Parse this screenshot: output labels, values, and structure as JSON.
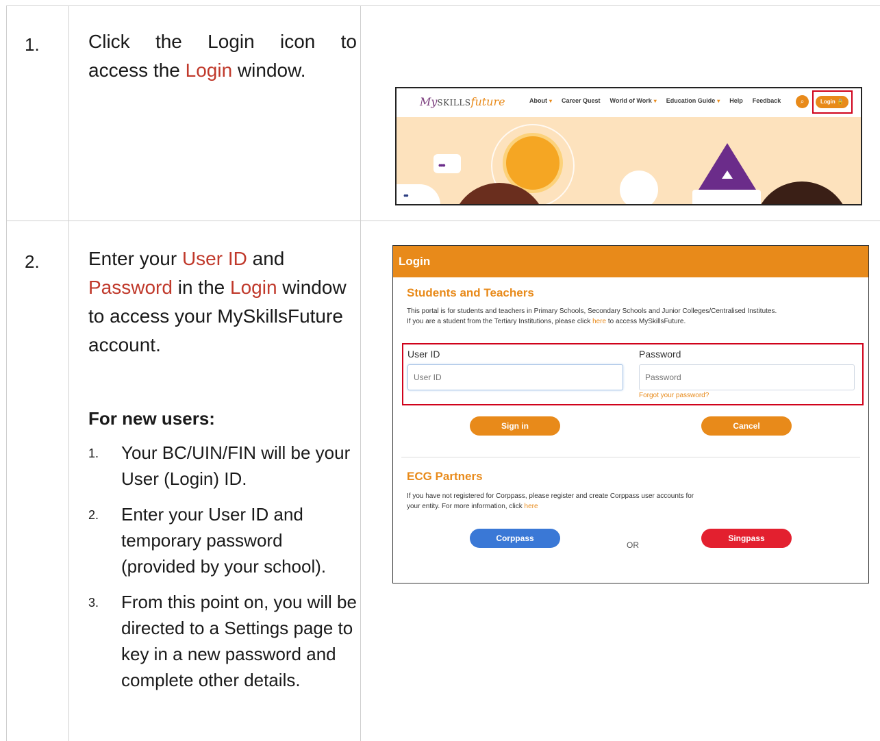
{
  "step1": {
    "number": "1.",
    "text_line1": [
      "Click",
      "the",
      "Login",
      "icon",
      "to"
    ],
    "text_pre": "access the",
    "text_highlight": "Login",
    "text_post": "window."
  },
  "step2": {
    "number": "2.",
    "p1": "Enter your",
    "h1": "User ID",
    "p2": "and",
    "h2": "Password",
    "p3": "in the",
    "h3": "Login",
    "p4": "window to access your MySkillsFuture account."
  },
  "new_users": {
    "title": "For new users:",
    "items": [
      {
        "n": "1.",
        "text": "Your BC/UIN/FIN will be your User (Login) ID."
      },
      {
        "n": "2.",
        "text": "Enter your User ID and temporary password (provided by your school)."
      },
      {
        "n": "3.",
        "text": "From this point on, you will be directed to a Settings page to key in a new password and complete other details."
      }
    ]
  },
  "screenshot1": {
    "logo_my": "My",
    "logo_skills": "SKILLS",
    "logo_future": "future",
    "nav": [
      {
        "label": "About",
        "caret": true
      },
      {
        "label": "Career Quest",
        "caret": false
      },
      {
        "label": "World of Work",
        "caret": true
      },
      {
        "label": "Education Guide",
        "caret": true
      },
      {
        "label": "Help",
        "caret": false
      },
      {
        "label": "Feedback",
        "caret": false
      }
    ],
    "login_label": "Login 🔒",
    "robot_dots": "•••",
    "ship_dots": "••"
  },
  "screenshot2": {
    "header": "Login",
    "students_title": "Students and Teachers",
    "students_desc_1": "This portal is for students and teachers in Primary Schools, Secondary Schools and Junior Colleges/Centralised Institutes.",
    "students_desc_2_pre": "If you are a student from the Tertiary Institutions, please click",
    "students_desc_2_link": "here",
    "students_desc_2_post": "to access MySkillsFuture.",
    "userid_label": "User ID",
    "userid_placeholder": "User ID",
    "password_label": "Password",
    "password_placeholder": "Password",
    "forgot": "Forgot your password?",
    "signin": "Sign in",
    "cancel": "Cancel",
    "ecg_title": "ECG Partners",
    "ecg_desc_1": "If you have not registered for Corppass, please register and create Corppass user accounts for",
    "ecg_desc_2_pre": "your entity. For more information, click",
    "ecg_desc_2_link": "here",
    "corppass": "Corppass",
    "or": "OR",
    "singpass": "Singpass"
  },
  "colors": {
    "accent_orange": "#e88a1a",
    "highlight_red": "#c0392b",
    "box_red": "#d0021b",
    "corppass_blue": "#3a78d6",
    "singpass_red": "#e3202f"
  }
}
